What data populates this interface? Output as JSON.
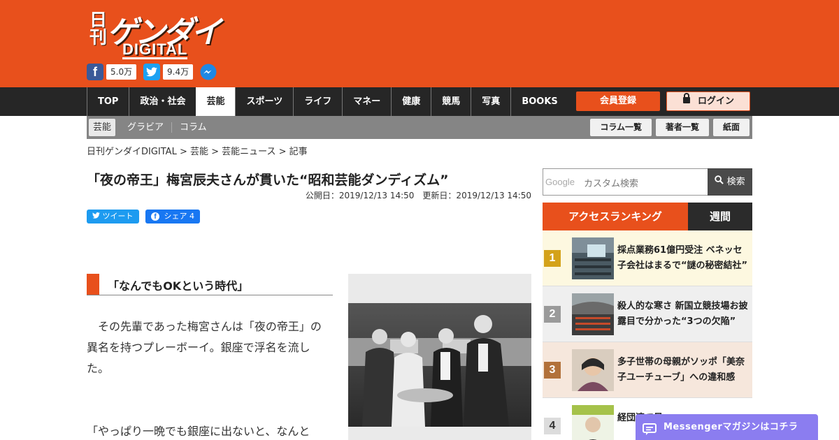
{
  "header": {
    "logo_nikkan": "日刊",
    "logo_gendai": "ゲンダイ",
    "logo_digital": "DIGITAL",
    "facebook_count": "5.0万",
    "twitter_count": "9.4万",
    "accent_color": "#e8501c"
  },
  "nav": {
    "items": [
      "TOP",
      "政治・社会",
      "芸能",
      "スポーツ",
      "ライフ",
      "マネー",
      "健康",
      "競馬",
      "写真",
      "BOOKS"
    ],
    "active": "芸能",
    "register_label": "会員登録",
    "login_label": "ログイン"
  },
  "subnav": {
    "items": [
      "芸能",
      "グラビア",
      "コラム"
    ],
    "right_buttons": [
      "コラム一覧",
      "著者一覧",
      "紙面"
    ]
  },
  "breadcrumb": "日刊ゲンダイDIGITAL > 芸能 > 芸能ニュース > 記事",
  "article": {
    "title": "「夜の帝王」梅宮辰夫さんが貫いた“昭和芸能ダンディズム”",
    "dates": "公開日：2019/12/13 14:50　更新日：2019/12/13 14:50",
    "tweet_label": "ツイート",
    "share_label": "シェア 4",
    "subheading": "「なんでもOKという時代」",
    "para1": "　その先輩であった梅宮さんは「夜の帝王」の異名を持つプレーボーイ。銀座で浮名を流した。",
    "para2": "「やっぱり一晩でも銀座に出ないと、なんと"
  },
  "sidebar": {
    "search_google": "Google",
    "search_placeholder": "カスタム検索",
    "search_button": "検索",
    "ranking_tab": "アクセスランキング",
    "ranking_period": "週間",
    "ranking": [
      {
        "rank": "1",
        "title": "採点業務61億円受注 ベネッセ子会社はまるで“謎の秘密結社”"
      },
      {
        "rank": "2",
        "title": "殺人的な寒さ 新国立競技場お披露目で分かった“3つの欠陥”"
      },
      {
        "rank": "3",
        "title": "多子世帯の母親がソッポ「美奈子ユーチューブ」への違和感"
      },
      {
        "rank": "4",
        "title": "経団連で景"
      }
    ]
  },
  "messenger_banner": "Messengerマガジンはコチラ"
}
